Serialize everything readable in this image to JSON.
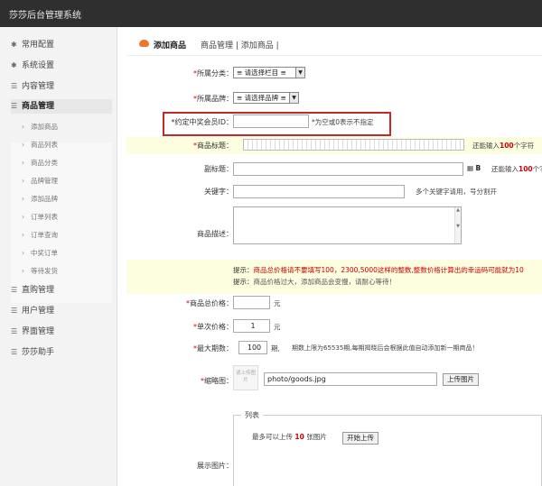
{
  "app": {
    "title": "莎莎后台管理系统"
  },
  "sidebar": {
    "items": [
      {
        "label": "常用配置",
        "icon": "gear-icon"
      },
      {
        "label": "系统设置",
        "icon": "wrench-icon"
      },
      {
        "label": "内容管理",
        "icon": "list-icon"
      },
      {
        "label": "商品管理",
        "icon": "list-icon"
      }
    ],
    "subitems": [
      "添加商品",
      "商品列表",
      "商品分类",
      "品牌管理",
      "添加品牌",
      "订单列表",
      "订单查询",
      "中奖订单",
      "等待发货"
    ],
    "bottom_items": [
      {
        "label": "直购管理",
        "icon": "list-icon"
      },
      {
        "label": "用户管理",
        "icon": "list-icon"
      },
      {
        "label": "界面管理",
        "icon": "list-icon"
      },
      {
        "label": "莎莎助手",
        "icon": "list-icon"
      }
    ]
  },
  "header": {
    "tab": "添加商品",
    "breadcrumb": "商品管理 | 添加商品 |"
  },
  "form": {
    "category": {
      "label": "所属分类：",
      "value": "≡ 请选择栏目 ≡"
    },
    "brand": {
      "label": "所属品牌：",
      "value": "≡ 请选择品牌 ≡"
    },
    "winner": {
      "label": "*约定中奖会员ID：",
      "value": "",
      "hint": "*为空或0表示不指定"
    },
    "title": {
      "label": "商品标题：",
      "hint_pre": "还能输入",
      "hint_num": "100",
      "hint_post": "个字符"
    },
    "subtitle": {
      "label": "副标题：",
      "hint_pre": "还能输入",
      "hint_num": "100",
      "hint_post": "个字"
    },
    "keywords": {
      "label": "关键字：",
      "hint": "多个关键字请用，号分割开"
    },
    "description": {
      "label": "商品描述："
    },
    "tips": {
      "prefix": "提示：",
      "line1": "商品总价格请不要填写100，2300,5000这样的整数,整数价格计算出的幸运码可能就为10",
      "line2": "商品价格过大，添加商品会变慢，请耐心等待！"
    },
    "total_price": {
      "label": "商品总价格：",
      "value": "",
      "unit": "元"
    },
    "unit_price": {
      "label": "单次价格：",
      "value": "1",
      "unit": "元"
    },
    "max_periods": {
      "label": "最大期数：",
      "value": "100",
      "unit": "期,",
      "hint": "期数上限为65535期,每期揭晓后会根据此值自动添加新一期商品！"
    },
    "thumbnail": {
      "label": "缩略图：",
      "placeholder": "请上传图片",
      "value": "photo/goods.jpg",
      "button": "上传图片"
    },
    "gallery": {
      "label": "展示图片：",
      "legend": "列表",
      "max_pre": "最多可以上传",
      "max_num": "10",
      "max_post": "张图片",
      "button": "开始上传"
    }
  },
  "colors": {
    "accent": "#f0742c",
    "highlight_border": "#c62828",
    "tip_red": "#cc0000",
    "yellow_band": "#fdfde0"
  }
}
